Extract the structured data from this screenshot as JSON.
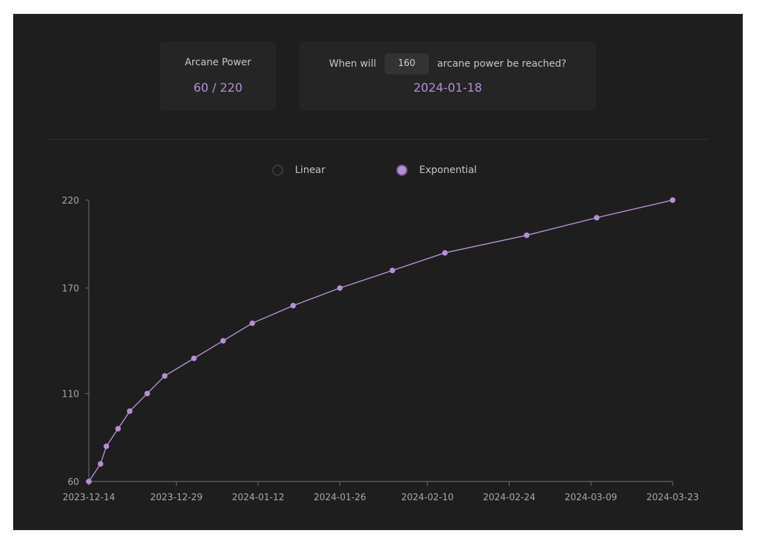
{
  "summary": {
    "power_label": "Arcane Power",
    "power_value": "60 / 220"
  },
  "query": {
    "prefix": "When will",
    "target_value": "160",
    "suffix": "arcane power be reached?",
    "result": "2024-01-18"
  },
  "modes": {
    "linear_label": "Linear",
    "exponential_label": "Exponential",
    "selected": "Exponential"
  },
  "colors": {
    "accent": "#b58ed6",
    "background": "#1e1e1e",
    "card": "#252525",
    "axis": "#777777"
  },
  "chart_data": {
    "type": "line",
    "title": "",
    "xlabel": "",
    "ylabel": "",
    "x_ticks": [
      "2023-12-14",
      "2023-12-29",
      "2024-01-12",
      "2024-01-26",
      "2024-02-10",
      "2024-02-24",
      "2024-03-09",
      "2024-03-23"
    ],
    "y_ticks": [
      60,
      110,
      170,
      220
    ],
    "xlim": [
      "2023-12-14",
      "2024-03-23"
    ],
    "ylim": [
      60,
      220
    ],
    "grid": false,
    "series": [
      {
        "points": [
          {
            "x": "2023-12-14",
            "y": 60
          },
          {
            "x": "2023-12-16",
            "y": 70
          },
          {
            "x": "2023-12-17",
            "y": 80
          },
          {
            "x": "2023-12-19",
            "y": 90
          },
          {
            "x": "2023-12-21",
            "y": 100
          },
          {
            "x": "2023-12-24",
            "y": 110
          },
          {
            "x": "2023-12-27",
            "y": 120
          },
          {
            "x": "2024-01-01",
            "y": 130
          },
          {
            "x": "2024-01-06",
            "y": 140
          },
          {
            "x": "2024-01-11",
            "y": 150
          },
          {
            "x": "2024-01-18",
            "y": 160
          },
          {
            "x": "2024-01-26",
            "y": 170
          },
          {
            "x": "2024-02-04",
            "y": 180
          },
          {
            "x": "2024-02-13",
            "y": 190
          },
          {
            "x": "2024-02-27",
            "y": 200
          },
          {
            "x": "2024-03-10",
            "y": 210
          },
          {
            "x": "2024-03-23",
            "y": 220
          }
        ]
      }
    ]
  }
}
